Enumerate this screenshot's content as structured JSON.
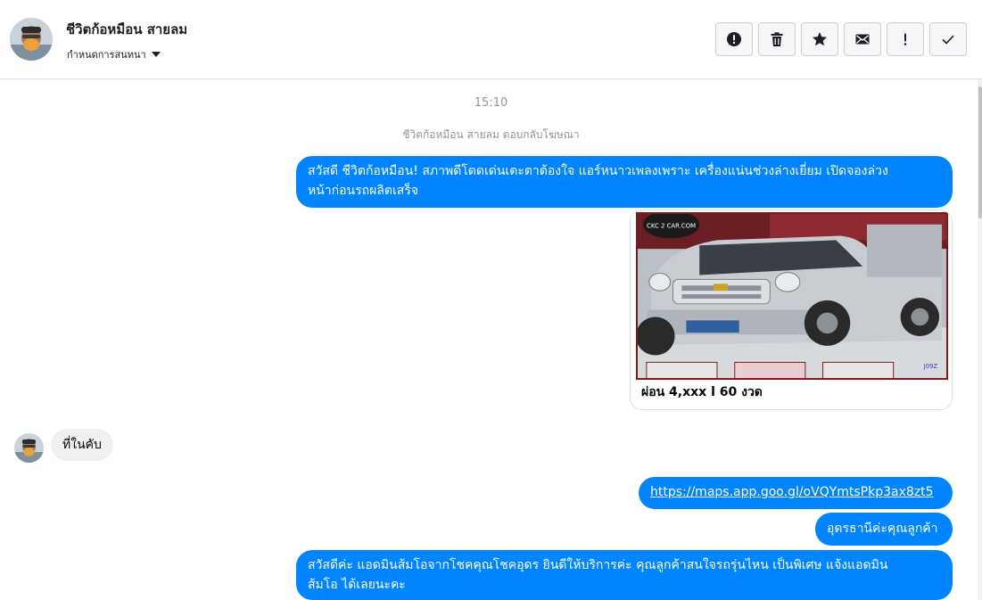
{
  "contact": {
    "name": "ชีวิตก้อหมือน สายลม",
    "assign_label": "กำหนดการสนทนา"
  },
  "toolbar": {
    "buttons": [
      {
        "icon": "alert-circle-icon",
        "label": "Mark as spam"
      },
      {
        "icon": "trash-icon",
        "label": "Delete"
      },
      {
        "icon": "star-icon",
        "label": "Star"
      },
      {
        "icon": "envelope-icon",
        "label": "Mark as unread"
      },
      {
        "icon": "exclamation-icon",
        "label": "Follow up"
      },
      {
        "icon": "check-icon",
        "label": "Mark as done"
      }
    ]
  },
  "thread": {
    "timestamp": "15:10",
    "system_note": "ชีวิตก้อหมือน สายลม ตอบกลับโฆษณา",
    "messages": [
      {
        "direction": "out",
        "text_line1": "สวัสดี ชีวิตก้อหมือน! สภาพดีโดดเด่นเตะตาต้องใจ แอร์หนาวเพลงเพราะ เครื่องแน่นช่วงล่างเยี่ยม เปิดจองล่วง",
        "text_line2": "หน้าก่อนรถผลิตเสร็จ"
      },
      {
        "direction": "out",
        "type": "card",
        "caption": "ผ่อน 4,xxx l 60 งวด",
        "image_watermark": "CKC 2 CAR.COM",
        "image_code": "J09Z"
      },
      {
        "direction": "in",
        "text": "ที่ในคับ"
      },
      {
        "direction": "out",
        "type": "link",
        "text": "https://maps.app.goo.gl/oVQYmtsPkp3ax8zt5"
      },
      {
        "direction": "out",
        "text": "อุดรธานีค่ะคุณลูกค้า"
      },
      {
        "direction": "out",
        "text_line1": "สวัสดีค่ะ แอดมินส้มโอจากโชคคุณโชคอุดร ยินดีให้บริการค่ะ   คุณลูกค้าสนใจรถรุ่นไหน เป็นพิเศษ แจ้งแอดมิน",
        "text_line2": "ส้มโอ ได้เลยนะคะ"
      }
    ]
  },
  "colors": {
    "outgoing_bubble": "#0084ff",
    "incoming_bubble": "#f1f0f0",
    "border": "#dddfe2"
  }
}
